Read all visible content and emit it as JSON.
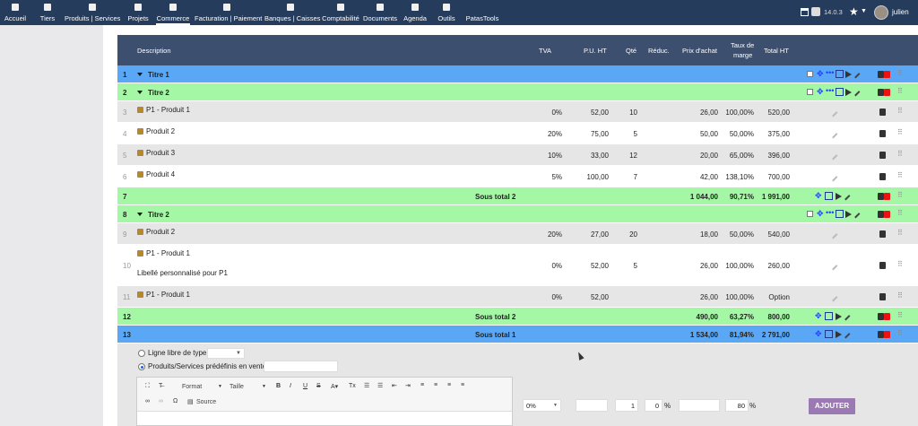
{
  "menu": [
    {
      "label": "Accueil",
      "icon": "home-icon"
    },
    {
      "label": "Tiers",
      "icon": "building-icon"
    },
    {
      "label": "Produits | Services",
      "icon": "cube-icon"
    },
    {
      "label": "Projets",
      "icon": "sitemap-icon"
    },
    {
      "label": "Commerce",
      "icon": "briefcase-icon"
    },
    {
      "label": "Facturation | Paiement",
      "icon": "file-invoice-icon"
    },
    {
      "label": "Banques | Caisses",
      "icon": "bank-icon"
    },
    {
      "label": "Comptabilité",
      "icon": "search-dollar-icon"
    },
    {
      "label": "Documents",
      "icon": "folder-icon"
    },
    {
      "label": "Agenda",
      "icon": "calendar-icon"
    },
    {
      "label": "Outils",
      "icon": "wrench-icon"
    },
    {
      "label": "PatasTools",
      "icon": ""
    }
  ],
  "topbar_right": {
    "version": "14.0.3",
    "username": "julien"
  },
  "columns": {
    "description": "Description",
    "tva": "TVA",
    "pu_ht": "P.U. HT",
    "qte": "Qté",
    "reduc": "Réduc.",
    "prix_achat": "Prix d'achat",
    "taux_marge_1": "Taux de",
    "taux_marge_2": "marge",
    "total_ht": "Total HT"
  },
  "rows": [
    {
      "n": "1",
      "kind": "title1",
      "label": "Titre 1"
    },
    {
      "n": "2",
      "kind": "title2",
      "label": "Titre 2"
    },
    {
      "n": "3",
      "kind": "line",
      "label": "P1 - Produit 1",
      "tva": "0%",
      "pu": "52,00",
      "qte": "10",
      "achat": "26,00",
      "marge": "100,00%",
      "total": "520,00"
    },
    {
      "n": "4",
      "kind": "line",
      "label": "Produit 2",
      "tva": "20%",
      "pu": "75,00",
      "qte": "5",
      "achat": "50,00",
      "marge": "50,00%",
      "total": "375,00"
    },
    {
      "n": "5",
      "kind": "line",
      "label": "Produit 3",
      "tva": "10%",
      "pu": "33,00",
      "qte": "12",
      "achat": "20,00",
      "marge": "65,00%",
      "total": "396,00"
    },
    {
      "n": "6",
      "kind": "line",
      "label": "Produit 4",
      "tva": "5%",
      "pu": "100,00",
      "qte": "7",
      "achat": "42,00",
      "marge": "138,10%",
      "total": "700,00"
    },
    {
      "n": "7",
      "kind": "sub2",
      "label": "Sous total 2",
      "achat": "1 044,00",
      "marge": "90,71%",
      "total": "1 991,00"
    },
    {
      "n": "8",
      "kind": "title2",
      "label": "Titre 2"
    },
    {
      "n": "9",
      "kind": "line",
      "label": "Produit 2",
      "tva": "20%",
      "pu": "27,00",
      "qte": "20",
      "achat": "18,00",
      "marge": "50,00%",
      "total": "540,00"
    },
    {
      "n": "10",
      "kind": "line2",
      "label": "P1 - Produit 1",
      "label2": "Libellé personnalisé pour P1",
      "tva": "0%",
      "pu": "52,00",
      "qte": "5",
      "achat": "26,00",
      "marge": "100,00%",
      "total": "260,00"
    },
    {
      "n": "11",
      "kind": "line",
      "label": "P1 - Produit 1",
      "tva": "0%",
      "pu": "52,00",
      "qte": "",
      "achat": "26,00",
      "marge": "100,00%",
      "total": "Option"
    },
    {
      "n": "12",
      "kind": "sub2",
      "label": "Sous total 2",
      "achat": "490,00",
      "marge": "63,27%",
      "total": "800,00"
    },
    {
      "n": "13",
      "kind": "sub1",
      "label": "Sous total 1",
      "achat": "1 534,00",
      "marge": "81,94%",
      "total": "2 791,00"
    }
  ],
  "form": {
    "radio_free": "Ligne libre de type",
    "radio_predef": "Produits/Services prédéfinis en vente",
    "editor": {
      "format": "Format",
      "size": "Taille",
      "source": "Source"
    },
    "tva_value": "0%",
    "qty_value": "1",
    "reduc_value": "0",
    "percent": "%",
    "marge_value": "80",
    "add_button": "AJOUTER"
  },
  "colors": {
    "title1": "#5aa8f5",
    "title2": "#a4f7a4",
    "header": "#3d4f6e",
    "topbar": "#263c5c",
    "add_button": "#9b7ab3"
  }
}
